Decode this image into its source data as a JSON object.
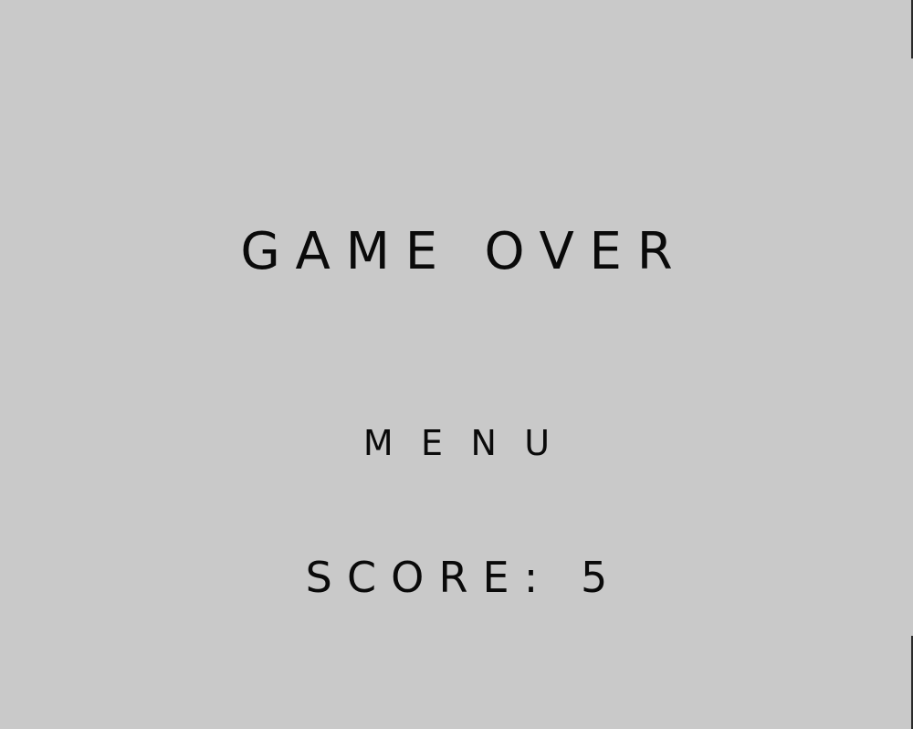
{
  "screen": {
    "background": "#c9c9c9",
    "text_color": "#0a0a0a"
  },
  "title": "GAME OVER",
  "menu_button_label": "MENU",
  "score": {
    "label": "SCORE:",
    "value": "5"
  }
}
